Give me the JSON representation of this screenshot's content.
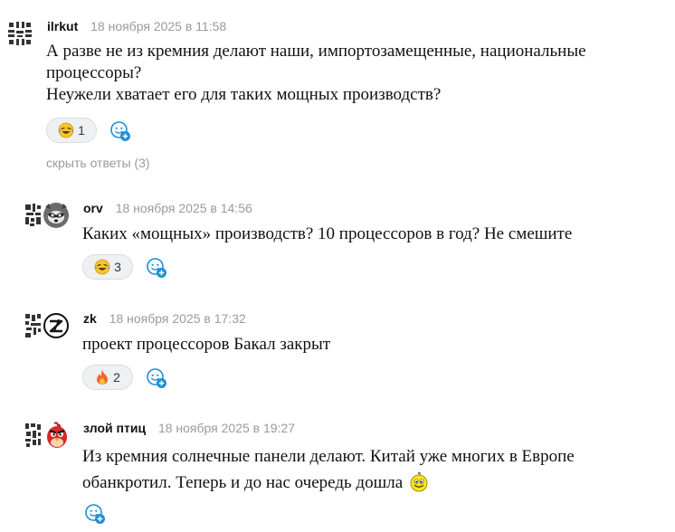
{
  "comments": [
    {
      "author": "ilrkut",
      "timestamp": "18 ноября 2025 в 11:58",
      "lines": [
        "А разве не из кремния делают наши, импортозамещенные, национальные",
        "процессоры?",
        "Неужели хватает его для таких мощных производств?"
      ],
      "reaction": {
        "emoji": "laughing-with-tears",
        "count": "1"
      },
      "hide_replies_label": "скрыть ответы (3)"
    },
    {
      "author": "orv",
      "timestamp": "18 ноября 2025 в 14:56",
      "lines": [
        "Каких «мощных» производств? 10 процессоров в год? Не смешите"
      ],
      "reaction": {
        "emoji": "laughing-with-tears",
        "count": "3"
      }
    },
    {
      "author": "zk",
      "timestamp": "18 ноября 2025 в 17:32",
      "lines": [
        "проект процессоров Бакал закрыт"
      ],
      "reaction": {
        "emoji": "fire",
        "count": "2"
      }
    },
    {
      "author": "злой птиц",
      "timestamp": "18 ноября 2025 в 19:27",
      "lines": [
        "Из кремния солнечные панели делают. Китай уже многих в Европе",
        "обанкротил. Теперь и до нас очередь дошла"
      ],
      "inline_emoji": "yellow-smiley-face-icon"
    }
  ],
  "colors": {
    "muted_text": "#9a9a9a",
    "pill_bg": "#eef0f2",
    "pill_border": "#d9dcdf",
    "add_reaction_blue": "#1f8fd6"
  }
}
